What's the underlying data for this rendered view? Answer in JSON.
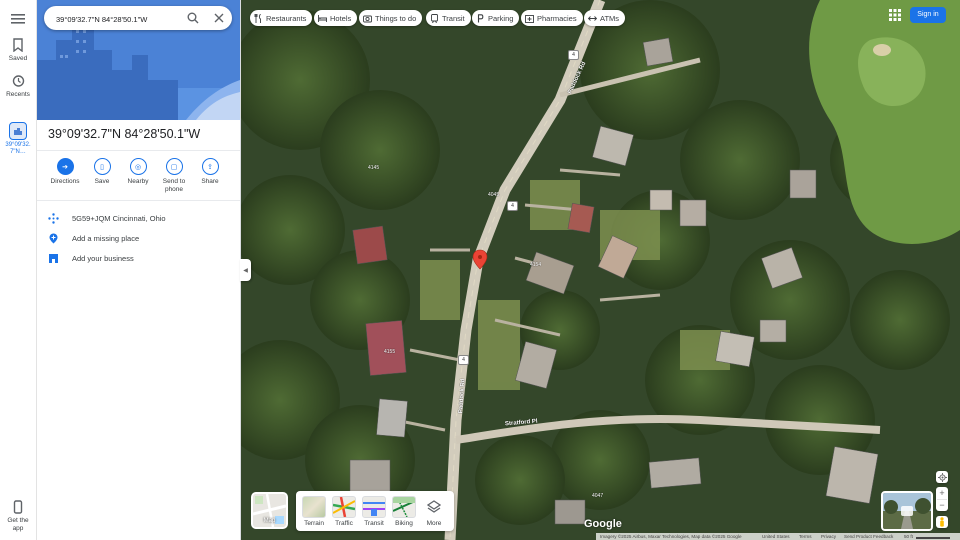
{
  "search": {
    "value": "39°09'32.7\"N 84°28'50.1\"W"
  },
  "rail": {
    "saved": "Saved",
    "recents": "Recents",
    "recent_place": "39°09'32.7\"N…",
    "get_app": "Get the app"
  },
  "chips": [
    "Restaurants",
    "Hotels",
    "Things to do",
    "Transit",
    "Parking",
    "Pharmacies",
    "ATMs"
  ],
  "panel": {
    "title": "39°09'32.7\"N 84°28'50.1\"W",
    "actions": [
      "Directions",
      "Save",
      "Nearby",
      "Send to phone",
      "Share"
    ],
    "info_rows": [
      "5G59+JQM Cincinnati, Ohio",
      "Add a missing place",
      "Add your business"
    ]
  },
  "topright": {
    "signin": "Sign in"
  },
  "layers": {
    "current": "Map",
    "options": [
      "Terrain",
      "Traffic",
      "Transit",
      "Biking",
      "More"
    ]
  },
  "map": {
    "road_labels": [
      "Paddock Rd",
      "Paddock Rd",
      "Stratford Pl"
    ],
    "route_shields": [
      "4",
      "4",
      "4"
    ],
    "house_numbers": [
      "4145",
      "4154",
      "4155",
      "4047",
      "4045"
    ],
    "logo": "Google"
  },
  "footer": {
    "attribution": "Imagery ©2025 Airbus, Maxar Technologies, Map data ©2025 Google",
    "country": "United States",
    "terms": "Terms",
    "privacy": "Privacy",
    "feedback": "Send Product Feedback",
    "scale": "50 ft"
  },
  "colors": {
    "accent": "#1a73e8",
    "pin": "#ea4335",
    "hero": "#4a7fd4"
  }
}
